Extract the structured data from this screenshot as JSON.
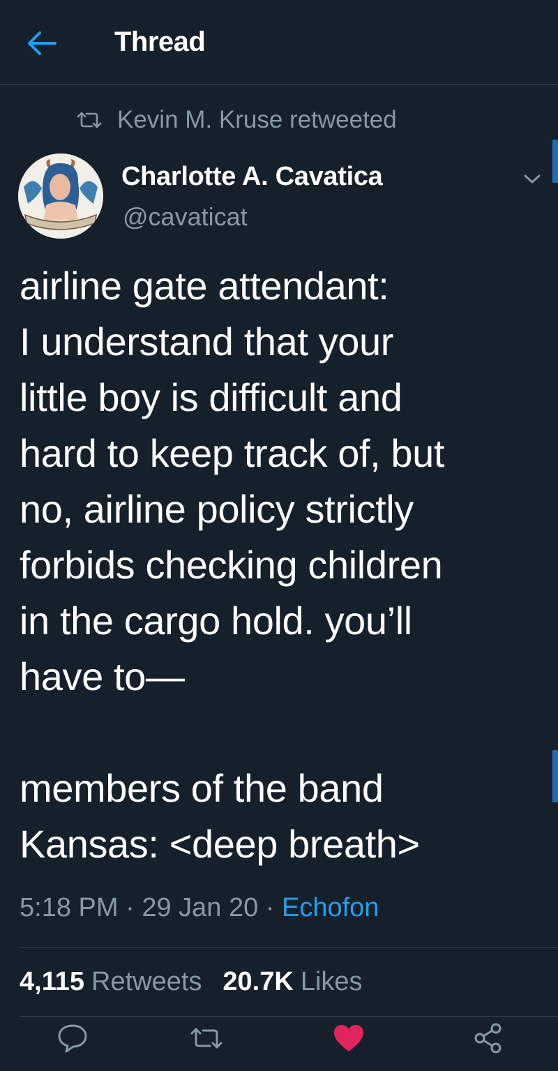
{
  "header": {
    "title": "Thread"
  },
  "retweet_context": {
    "text": "Kevin M. Kruse retweeted"
  },
  "author": {
    "display_name": "Charlotte A. Cavatica",
    "handle": "@cavaticat"
  },
  "tweet": {
    "paragraph_1": [
      "airline gate attendant:",
      "I understand that your",
      "little boy is difficult and",
      "hard to keep track of, but",
      "no, airline policy strictly",
      "forbids checking children",
      "in the cargo hold. you’ll",
      "have to—"
    ],
    "paragraph_2": [
      "members of the band",
      "Kansas: <deep breath>"
    ],
    "time": "5:18 PM",
    "date": "29 Jan 20",
    "separator": "·",
    "source": "Echofon"
  },
  "stats": {
    "retweets_count": "4,115",
    "retweets_label": "Retweets",
    "likes_count": "20.7K",
    "likes_label": "Likes"
  },
  "actions": {
    "reply_icon": "speech-bubble-icon",
    "retweet_icon": "retweet-arrows-icon",
    "like_icon": "heart-icon",
    "share_icon": "share-nodes-icon",
    "like_active": true
  },
  "colors": {
    "background": "#15202b",
    "accent": "#1da1f2",
    "secondary_text": "#8899a6",
    "like": "#e0245e",
    "divider": "#38444d"
  }
}
